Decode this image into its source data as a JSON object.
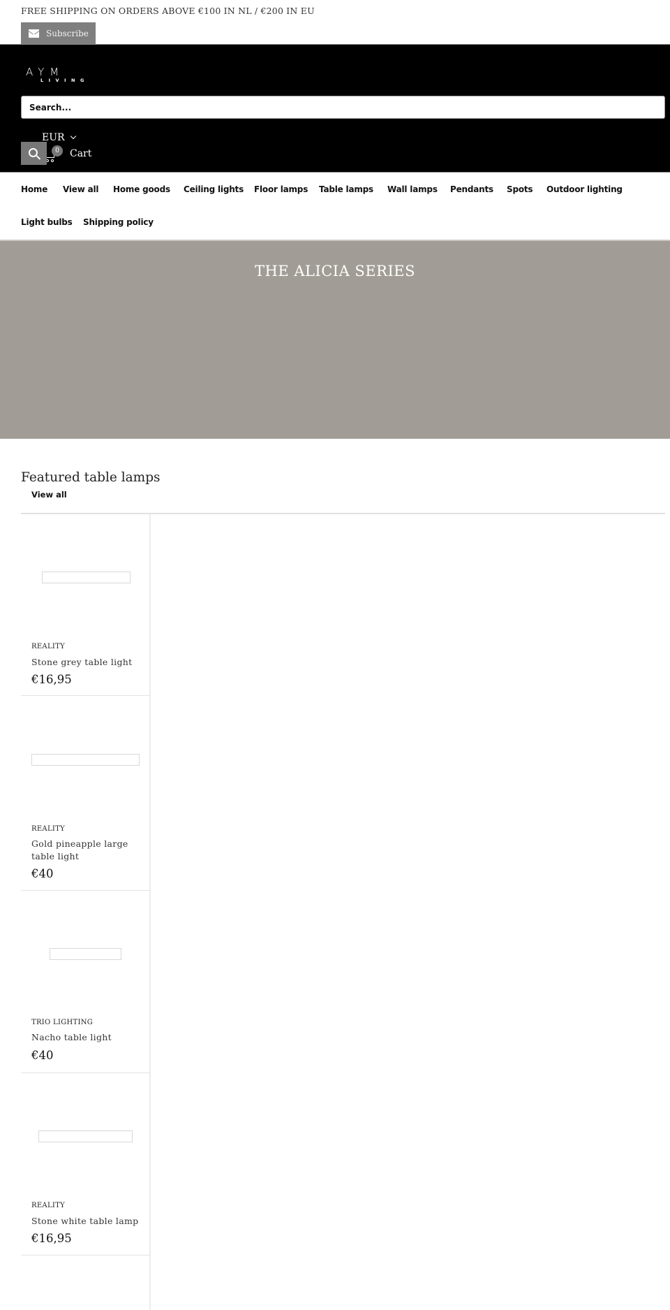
{
  "announcement": {
    "text": "FREE SHIPPING ON ORDERS ABOVE €100 IN NL / €200 IN EU",
    "subscribe_label": "Subscribe",
    "subscribe_icon": "mail-icon"
  },
  "header": {
    "logo_top": "AYM",
    "logo_bottom": "LIVING",
    "search_placeholder": "Search...",
    "currency": "EUR",
    "search_icon": "search-icon",
    "cart_icon": "cart-icon",
    "cart_count": "0",
    "cart_label": "Cart"
  },
  "nav": {
    "items": [
      {
        "label": "Home"
      },
      {
        "label": "View all"
      },
      {
        "label": "Home goods"
      },
      {
        "label": "Ceiling lights"
      },
      {
        "label": "Floor lamps"
      },
      {
        "label": "Table lamps"
      },
      {
        "label": "Wall lamps"
      },
      {
        "label": "Pendants"
      },
      {
        "label": "Spots"
      },
      {
        "label": "Outdoor lighting"
      },
      {
        "label": "Light bulbs"
      },
      {
        "label": "Shipping policy"
      }
    ]
  },
  "hero": {
    "title": "THE ALICIA SERIES",
    "background_color": "#a19c95"
  },
  "featured": {
    "title": "Featured table lamps",
    "view_all_label": "View all",
    "products": [
      {
        "vendor": "REALITY",
        "title": "Stone grey table light",
        "price": "€16,95"
      },
      {
        "vendor": "REALITY",
        "title": "Gold pineapple large table light",
        "price": "€40"
      },
      {
        "vendor": "TRIO LIGHTING",
        "title": "Nacho table light",
        "price": "€40"
      },
      {
        "vendor": "REALITY",
        "title": "Stone white table lamp",
        "price": "€16,95"
      }
    ]
  }
}
